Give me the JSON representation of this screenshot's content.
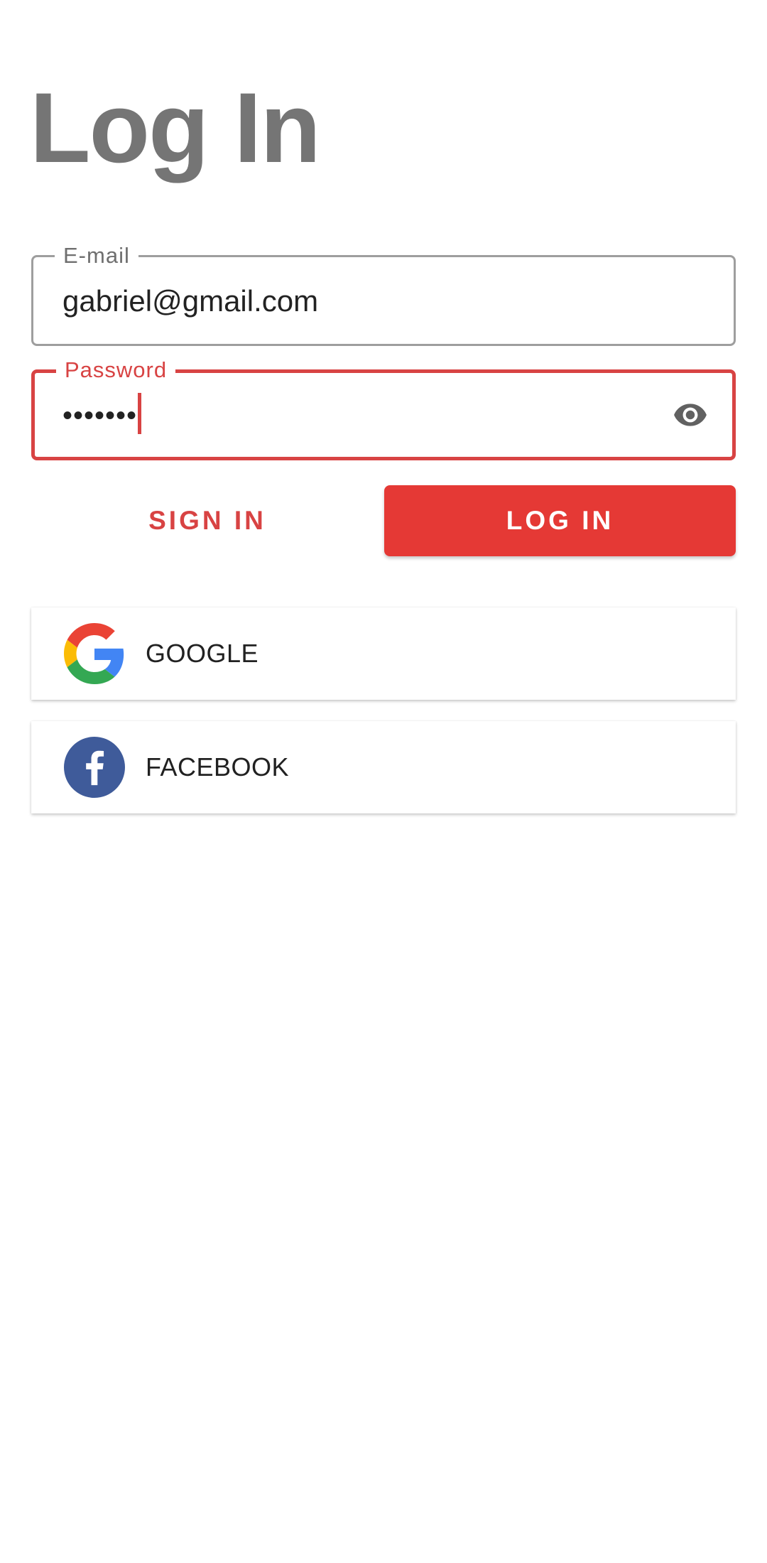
{
  "page": {
    "title": "Log In"
  },
  "form": {
    "email": {
      "label": "E-mail",
      "value": "gabriel@gmail.com"
    },
    "password": {
      "label": "Password",
      "masked_value": "•••••••"
    }
  },
  "actions": {
    "sign_in_label": "SIGN IN",
    "log_in_label": "LOG IN"
  },
  "social": {
    "google_label": "GOOGLE",
    "facebook_label": "FACEBOOK"
  },
  "icons": {
    "password_toggle": "eye-icon",
    "google": "google-logo-icon",
    "facebook": "facebook-logo-icon"
  },
  "colors": {
    "accent": "#e53935",
    "error_outline": "#d84343",
    "title_gray": "#757575",
    "outline_gray": "#9e9e9e",
    "facebook_blue": "#3b5998"
  }
}
